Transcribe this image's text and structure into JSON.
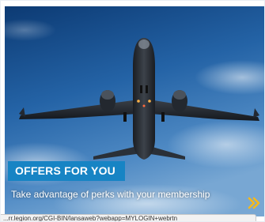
{
  "promo": {
    "badge_label": "OFFERS FOR YOU",
    "description": "Take advantage of perks with your membership",
    "next_icon": "double-chevron-right-icon",
    "image": "airplane-taking-off-photo"
  },
  "status_bar": {
    "url": "...rr.legion.org/CGI-BIN/lansaweb?webapp=MYLOGIN+webrtn"
  },
  "colors": {
    "badge_bg": "#1784c4",
    "chevron": "#f5b81c",
    "sky_top": "#0c3a73",
    "sky_bottom": "#6a9fd0"
  }
}
